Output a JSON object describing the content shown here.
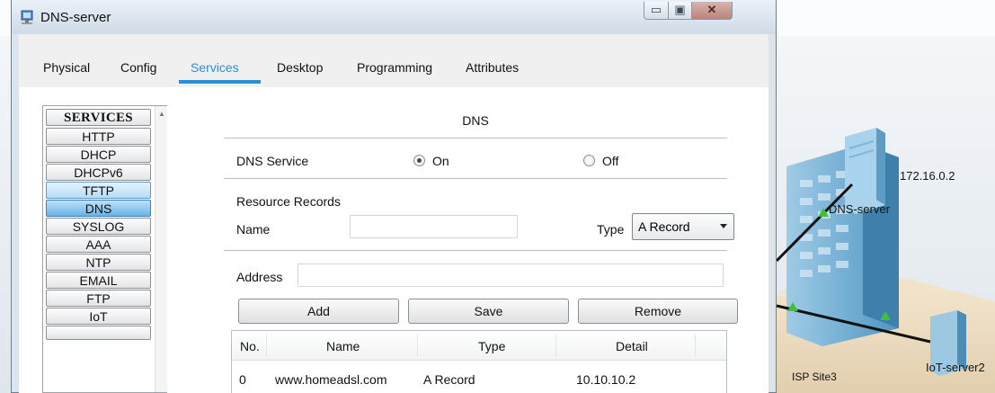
{
  "window": {
    "title": "DNS-server",
    "controls": {
      "minimize": "▭",
      "maximize": "▣",
      "close": "✕"
    }
  },
  "tabs": [
    {
      "label": "Physical"
    },
    {
      "label": "Config"
    },
    {
      "label": "Services",
      "active": true
    },
    {
      "label": "Desktop"
    },
    {
      "label": "Programming"
    },
    {
      "label": "Attributes"
    }
  ],
  "services": {
    "header": "SERVICES",
    "items": [
      "HTTP",
      "DHCP",
      "DHCPv6",
      "TFTP",
      "DNS",
      "SYSLOG",
      "AAA",
      "NTP",
      "EMAIL",
      "FTP",
      "IoT"
    ],
    "selected": "DNS",
    "highlighted": "TFTP"
  },
  "dns": {
    "title": "DNS",
    "service_label": "DNS Service",
    "on_label": "On",
    "off_label": "Off",
    "service_on": true,
    "records_heading": "Resource Records",
    "name_label": "Name",
    "name_value": "",
    "type_label": "Type",
    "type_value": "A Record",
    "address_label": "Address",
    "address_value": "",
    "add_label": "Add",
    "save_label": "Save",
    "remove_label": "Remove",
    "table": {
      "columns": [
        "No.",
        "Name",
        "Type",
        "Detail"
      ],
      "rows": [
        {
          "no": "0",
          "name": "www.homeadsl.com",
          "type": "A Record",
          "detail": "10.10.10.2"
        }
      ]
    }
  },
  "topology": {
    "ip_label": "172.16.0.2",
    "dns_server_label": "DNS-server",
    "iot_server_label": "IoT-server2",
    "isp_label": "ISP Site3",
    "link_color": "#111111",
    "port_color": "#3fbf3f"
  }
}
